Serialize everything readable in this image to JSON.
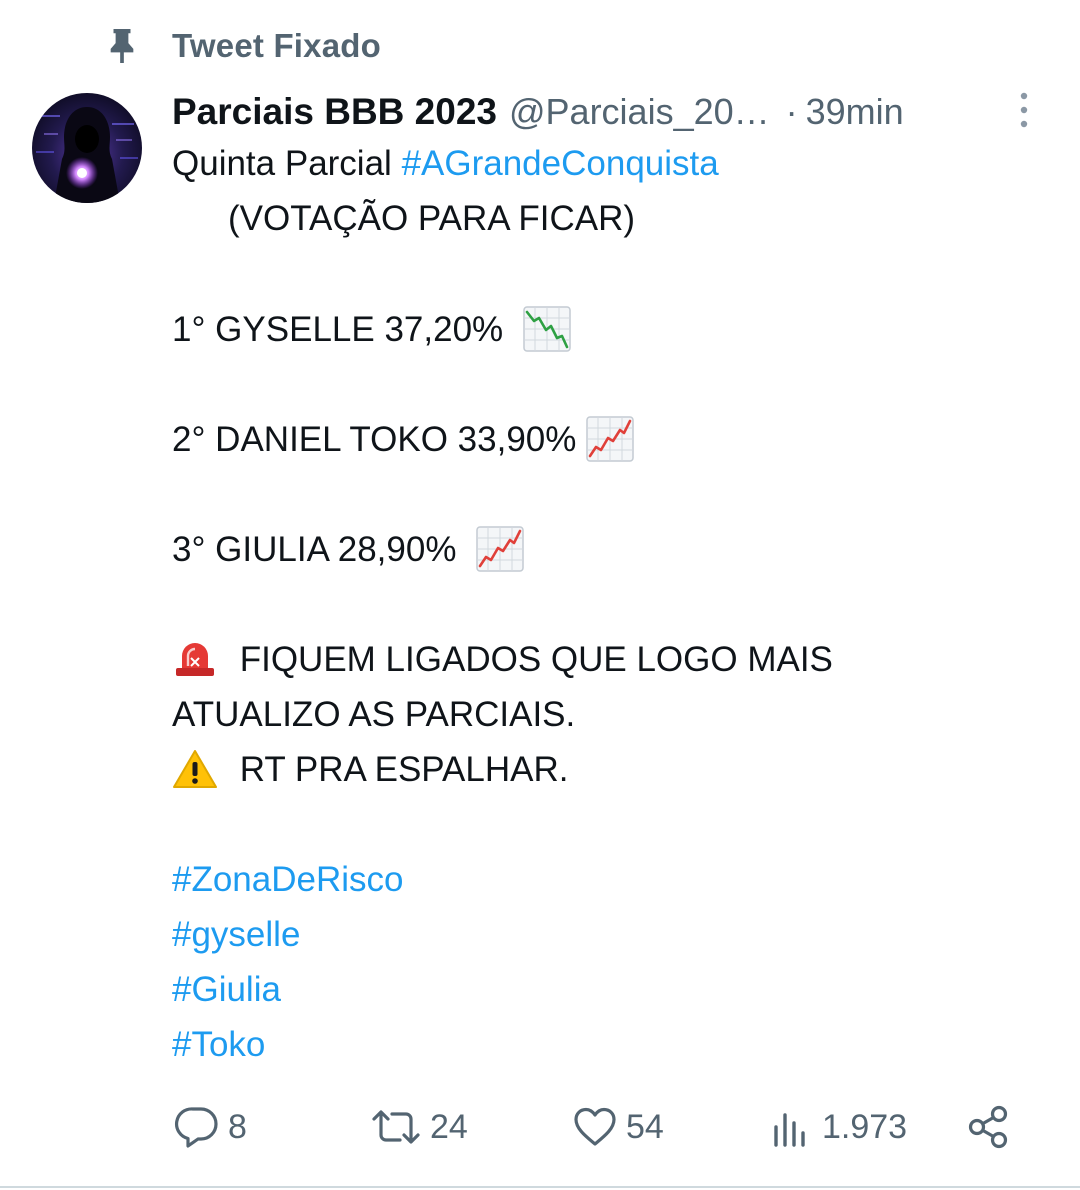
{
  "pinned": {
    "label": "Tweet Fixado",
    "icon": "pin-icon"
  },
  "tweet": {
    "author": {
      "display_name": "Parciais BBB 2023",
      "handle": "@Parciais_20…",
      "avatar_icon": "hooded-figure-avatar"
    },
    "separator": "·",
    "timestamp": "39min",
    "more_icon": "more-vertical-icon",
    "body": {
      "line1_text": "Quinta Parcial",
      "line1_hashtag": "#AGrandeConquista",
      "line2": "(VOTAÇÃO PARA FICAR)",
      "rank1": "1° GYSELLE 37,20%",
      "rank1_icon": "chart-decreasing-emoji",
      "rank2": "2° DANIEL TOKO 33,90%",
      "rank2_icon": "chart-increasing-emoji",
      "rank3": "3° GIULIA 28,90%",
      "rank3_icon": "chart-increasing-emoji",
      "alert_line1": "FIQUEM LIGADOS QUE LOGO MAIS",
      "alert_line2": "ATUALIZO AS PARCIAIS.",
      "alert_icon": "police-light-emoji",
      "warning_line": "RT PRA ESPALHAR.",
      "warning_icon": "warning-emoji",
      "hashtags": [
        "#ZonaDeRisco",
        "#gyselle",
        "#Giulia",
        "#Toko"
      ]
    },
    "actions": {
      "replies": "8",
      "retweets": "24",
      "likes": "54",
      "views": "1.973"
    }
  },
  "colors": {
    "text": "#0f1419",
    "secondary": "#536471",
    "link": "#1d9bf0"
  }
}
